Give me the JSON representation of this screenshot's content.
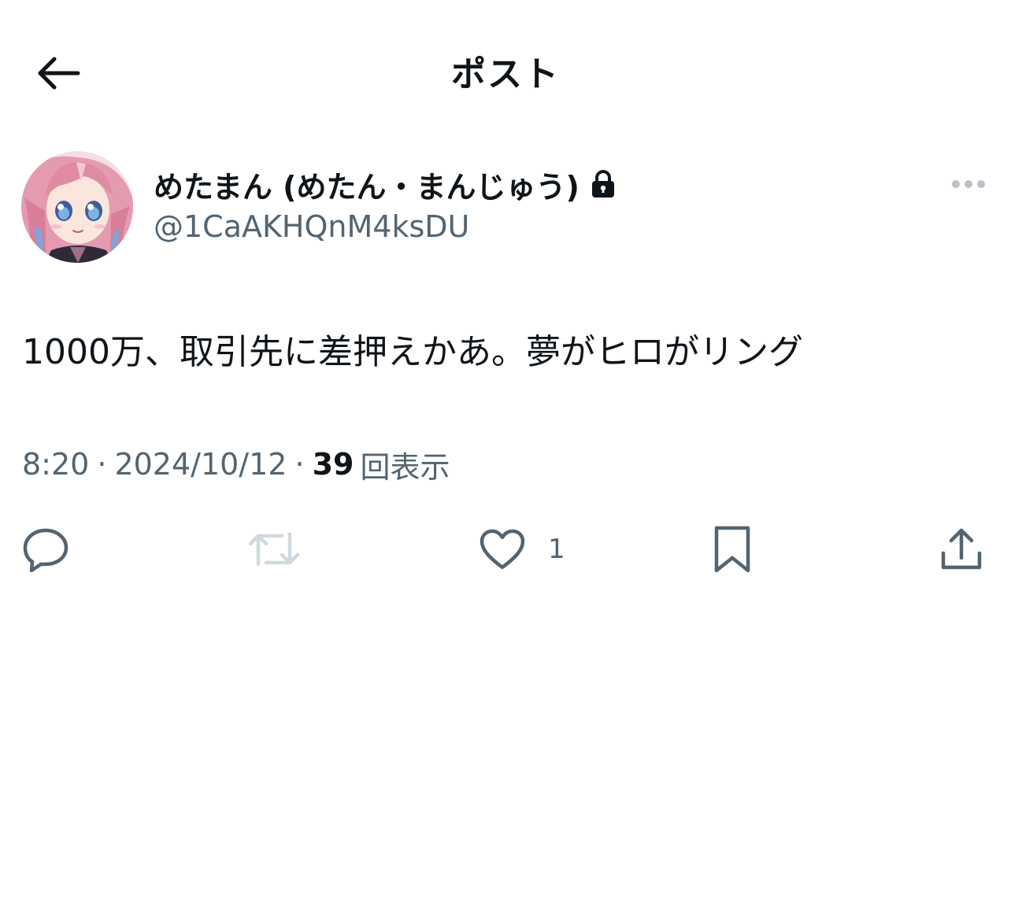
{
  "header": {
    "title": "ポスト",
    "back_icon": "arrow-left-icon"
  },
  "author": {
    "display_name": "めたまん (めたん・まんじゅう)",
    "handle": "@1CaAKHQnM4ksDU",
    "protected_icon": "lock-icon",
    "more_icon": "more-horizontal-icon"
  },
  "post": {
    "text": "1000万、取引先に差押えかあ。夢がヒロがリング",
    "time": "8:20",
    "date": "2024/10/12",
    "separator": "·",
    "views_count": "39",
    "views_label": "回表示"
  },
  "actions": {
    "reply_icon": "reply-icon",
    "repost_icon": "repost-icon",
    "like_icon": "heart-icon",
    "like_count": "1",
    "bookmark_icon": "bookmark-icon",
    "share_icon": "share-icon"
  },
  "colors": {
    "text_primary": "#0f1419",
    "text_secondary": "#536471",
    "disabled": "#cfd9de",
    "more_dots": "#b9c2ca"
  }
}
